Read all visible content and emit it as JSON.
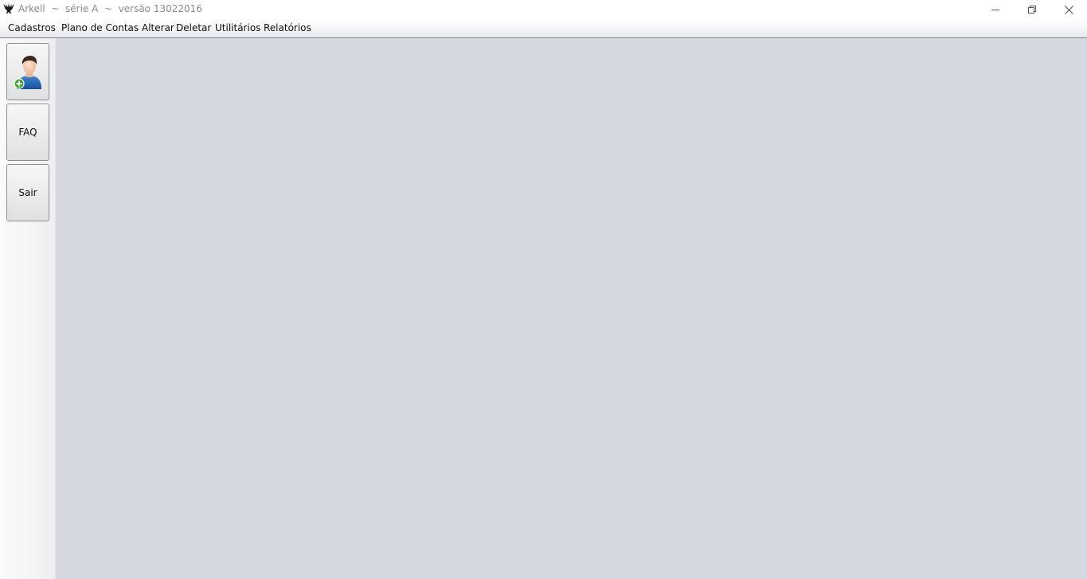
{
  "window": {
    "title": "Arkell  ~  série A  ~  versão 13022016",
    "icons": {
      "app": "bird-logo-icon",
      "minimize": "minimize-icon",
      "maximize": "restore-icon",
      "close": "close-icon"
    }
  },
  "menu": {
    "items": [
      {
        "label": "Cadastros"
      },
      {
        "label": "Plano de Contas"
      },
      {
        "label": "Alterar"
      },
      {
        "label": "Deletar"
      },
      {
        "label": "Utilitários"
      },
      {
        "label": "Relatórios"
      }
    ]
  },
  "toolbar": {
    "user_button_icon": "add-user-icon",
    "faq_label": "FAQ",
    "sair_label": "Sair"
  },
  "colors": {
    "desktop_background": "#d5d8e1",
    "user_shirt": "#1f63b5",
    "add_badge": "#3aa629"
  }
}
